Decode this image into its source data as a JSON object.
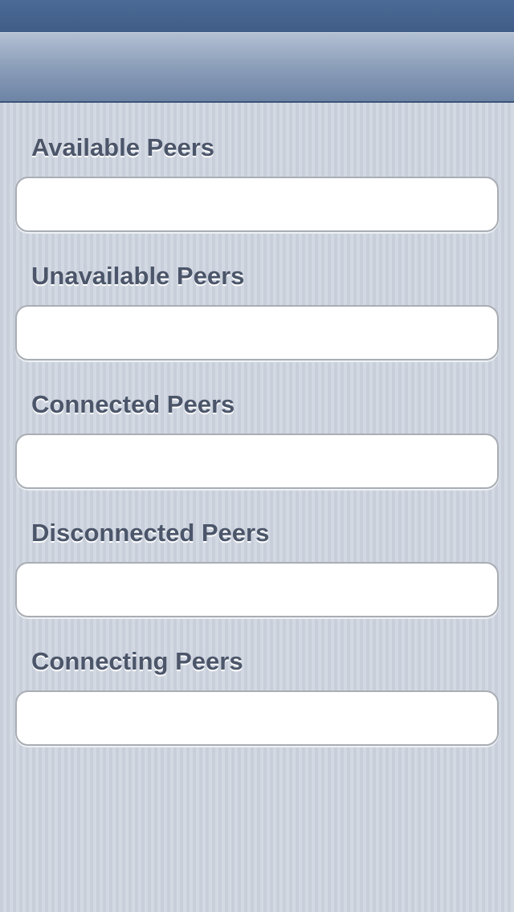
{
  "status_bar": {},
  "nav_bar": {
    "title": ""
  },
  "sections": [
    {
      "label": "Available Peers",
      "value": ""
    },
    {
      "label": "Unavailable Peers",
      "value": ""
    },
    {
      "label": "Connected Peers",
      "value": ""
    },
    {
      "label": "Disconnected Peers",
      "value": ""
    },
    {
      "label": "Connecting Peers",
      "value": ""
    }
  ],
  "colors": {
    "nav_top": "#b3c0d3",
    "nav_bottom": "#6d84a5",
    "status_bar": "#3f5d87",
    "background": "#cfd5df",
    "label_text": "#4c566a",
    "field_border": "#a9adb4"
  }
}
